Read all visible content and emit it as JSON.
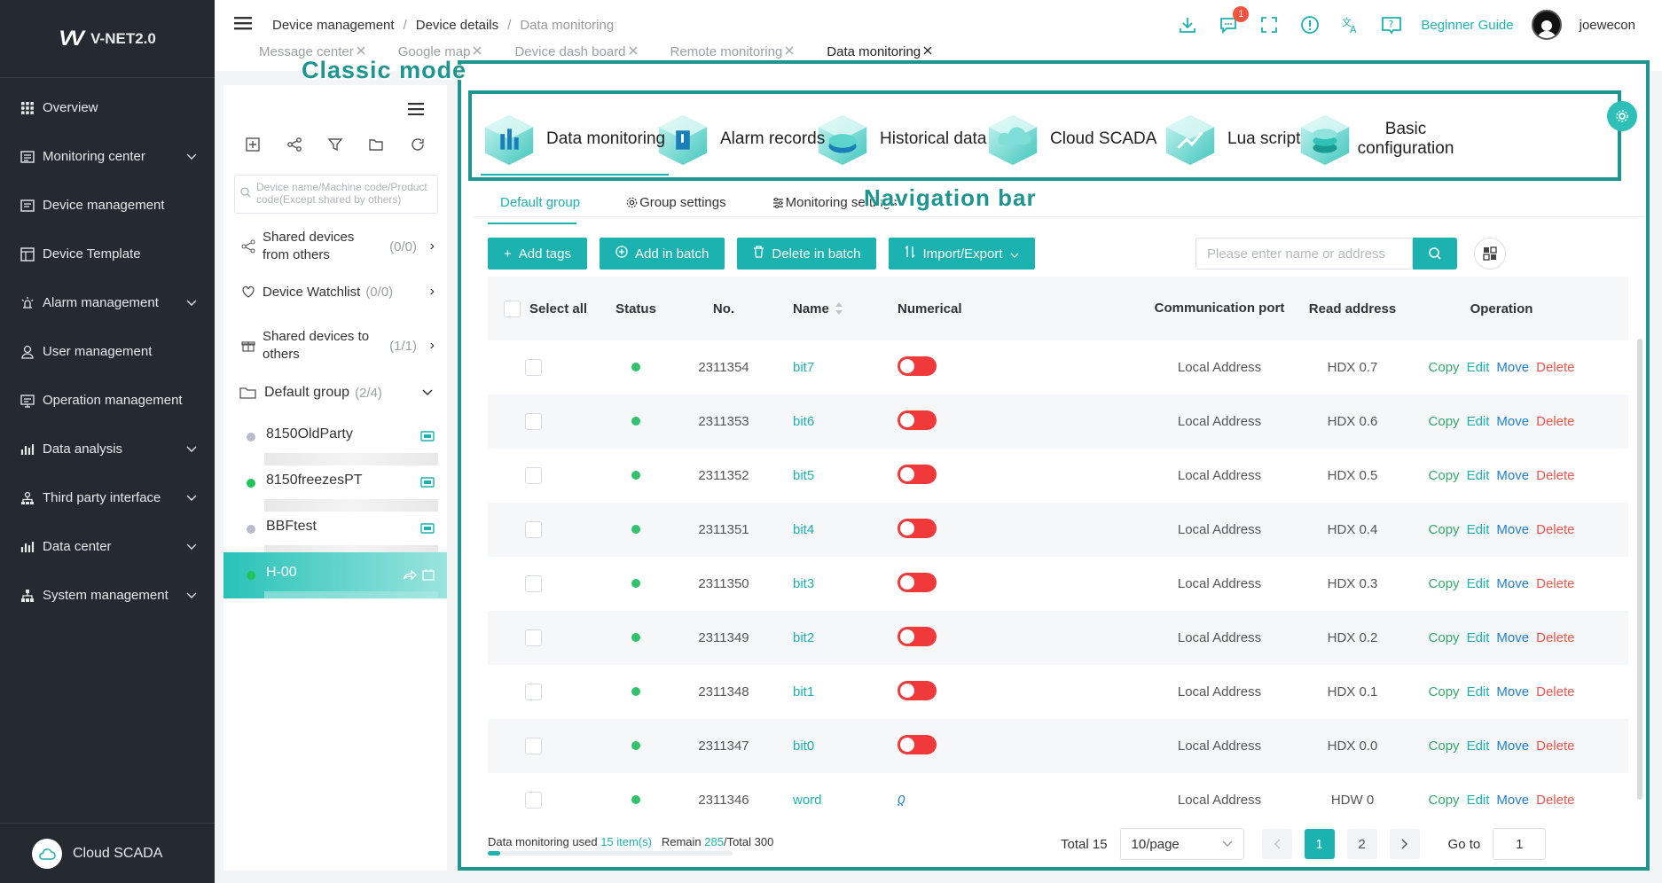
{
  "app": {
    "name": "V-NET2.0",
    "logo_text": "VV"
  },
  "sidebar": {
    "items": [
      {
        "label": "Overview",
        "icon": "grid-icon",
        "chevron": false
      },
      {
        "label": "Monitoring center",
        "icon": "monitor-icon",
        "chevron": true
      },
      {
        "label": "Device management",
        "icon": "device-icon",
        "chevron": false
      },
      {
        "label": "Device Template",
        "icon": "template-icon",
        "chevron": false
      },
      {
        "label": "Alarm management",
        "icon": "alarm-icon",
        "chevron": true
      },
      {
        "label": "User management",
        "icon": "user-icon",
        "chevron": false
      },
      {
        "label": "Operation management",
        "icon": "operation-icon",
        "chevron": false
      },
      {
        "label": "Data analysis",
        "icon": "chart-icon",
        "chevron": true
      },
      {
        "label": "Third party interface",
        "icon": "interface-icon",
        "chevron": true
      },
      {
        "label": "Data center",
        "icon": "data-icon",
        "chevron": true
      },
      {
        "label": "System management",
        "icon": "system-icon",
        "chevron": true
      }
    ],
    "bottom_label": "Cloud SCADA"
  },
  "breadcrumb": {
    "items": [
      "Device management",
      "Device details",
      "Data monitoring"
    ]
  },
  "header": {
    "badge_count": "1",
    "guide": "Beginner Guide",
    "username": "joewecon"
  },
  "tabs": [
    "Message center",
    "Google map",
    "Device dash board",
    "Remote monitoring",
    "Data monitoring"
  ],
  "annotations": {
    "classic": "Classic mode",
    "navigation": "Navigation bar"
  },
  "leftpanel": {
    "search_placeholder": "Device name/Machine code/Product code(Except shared by others)",
    "shared_from": {
      "label": "Shared devices from others",
      "count": "(0/0)"
    },
    "watchlist": {
      "label": "Device Watchlist",
      "count": "(0/0)"
    },
    "shared_to": {
      "label": "Shared devices to others",
      "count": "(1/1)"
    },
    "group": {
      "label": "Default group",
      "count": "(2/4)"
    },
    "devices": [
      {
        "name": "8150OldParty",
        "status_color": "#b6bccb",
        "selected": false
      },
      {
        "name": "8150freezesPT",
        "status_color": "#20c45a",
        "selected": false
      },
      {
        "name": "BBFtest",
        "status_color": "#b6bccb",
        "selected": false
      },
      {
        "name": "H-00",
        "status_color": "#20c45a",
        "selected": true
      }
    ]
  },
  "nav": [
    {
      "label": "Data monitoring",
      "active": true
    },
    {
      "label": "Alarm records",
      "active": false
    },
    {
      "label": "Historical data",
      "active": false
    },
    {
      "label": "Cloud SCADA",
      "active": false
    },
    {
      "label": "Lua script",
      "active": false
    },
    {
      "label": "Basic configuration",
      "active": false
    }
  ],
  "subtabs": {
    "default": "Default group",
    "group_settings": "Group settings",
    "monitoring_settings": "Monitoring settings"
  },
  "toolbar": {
    "add_tags": "Add tags",
    "add_batch": "Add in batch",
    "delete_batch": "Delete in batch",
    "import_export": "Import/Export",
    "search_placeholder": "Please enter name or address"
  },
  "table": {
    "headers": {
      "select": "Select all",
      "status": "Status",
      "no": "No.",
      "name": "Name",
      "numerical": "Numerical",
      "port": "Communication port",
      "address": "Read address",
      "operation": "Operation"
    },
    "ops": {
      "copy": "Copy",
      "edit": "Edit",
      "move": "Move",
      "delete": "Delete"
    },
    "rows": [
      {
        "no": "2311354",
        "name": "bit7",
        "value_type": "toggle",
        "value": "",
        "port": "Local Address",
        "address": "HDX 0.7"
      },
      {
        "no": "2311353",
        "name": "bit6",
        "value_type": "toggle",
        "value": "",
        "port": "Local Address",
        "address": "HDX 0.6"
      },
      {
        "no": "2311352",
        "name": "bit5",
        "value_type": "toggle",
        "value": "",
        "port": "Local Address",
        "address": "HDX 0.5"
      },
      {
        "no": "2311351",
        "name": "bit4",
        "value_type": "toggle",
        "value": "",
        "port": "Local Address",
        "address": "HDX 0.4"
      },
      {
        "no": "2311350",
        "name": "bit3",
        "value_type": "toggle",
        "value": "",
        "port": "Local Address",
        "address": "HDX 0.3"
      },
      {
        "no": "2311349",
        "name": "bit2",
        "value_type": "toggle",
        "value": "",
        "port": "Local Address",
        "address": "HDX 0.2"
      },
      {
        "no": "2311348",
        "name": "bit1",
        "value_type": "toggle",
        "value": "",
        "port": "Local Address",
        "address": "HDX 0.1"
      },
      {
        "no": "2311347",
        "name": "bit0",
        "value_type": "toggle",
        "value": "",
        "port": "Local Address",
        "address": "HDX 0.0"
      },
      {
        "no": "2311346",
        "name": "word",
        "value_type": "number",
        "value": "0",
        "port": "Local Address",
        "address": "HDW 0"
      }
    ]
  },
  "footer": {
    "used_prefix": "Data monitoring used",
    "used": "15 item(s)",
    "remain_prefix": "Remain",
    "remain": "285",
    "total_suffix": "/Total 300",
    "usage_fraction": 0.05,
    "total": "Total 15",
    "page_size": "10/page",
    "pages": [
      "1",
      "2"
    ],
    "current_page": "1",
    "goto_label": "Go to",
    "goto_value": "1"
  },
  "colors": {
    "accent": "#1bb2b0",
    "annotation": "#1f9590",
    "sidebar_bg": "#252a31",
    "toggle_off": "#f0393a"
  }
}
